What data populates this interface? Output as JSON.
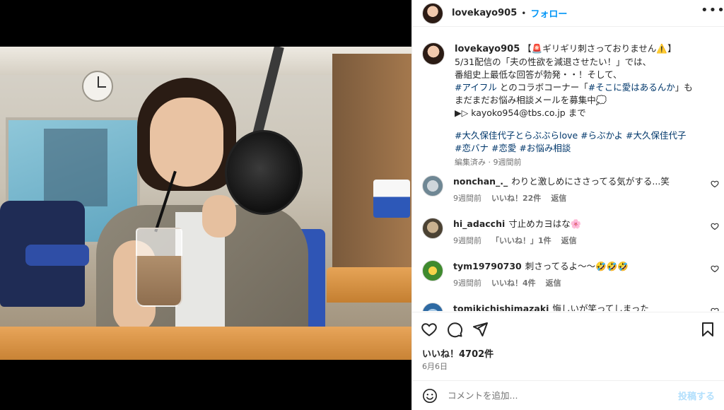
{
  "post": {
    "username": "lovekayo905",
    "dot": "•",
    "follow_label": "フォロー",
    "more_icon": "more-horizontal-icon"
  },
  "caption": {
    "username": "lovekayo905",
    "line1": "【🚨ギリギリ刺さっておりません⚠️】",
    "line2": "5/31配信の「夫の性欲を減退させたい！」では、",
    "line3": "番組史上最低な回答が勃発・・！そして、",
    "line4_tag": "#アイフル",
    "line4_mid": " とのコラボコーナー「",
    "line4_tag2": "#そこに愛はあるんか",
    "line4_end": "」も",
    "line5": "まだまだお悩み相談メールを募集中💭",
    "line6": "▶︎▷ kayoko954@tbs.co.jp まで",
    "hashtags_line1": "#大久保佳代子とらぶぶらlove #らぶかよ #大久保佳代子",
    "hashtags_line2": "#恋バナ #恋愛 #お悩み相談",
    "meta": "編集済み · 9週間前"
  },
  "comments": [
    {
      "username": "nonchan_._",
      "text": "わりと激しめにささってる気がする...笑",
      "time": "9週間前",
      "likes": "いいね！22件",
      "reply": "返信"
    },
    {
      "username": "hi_adacchi",
      "text": "寸止めカヨはな🌸",
      "time": "9週間前",
      "likes": "「いいね！」1件",
      "reply": "返信"
    },
    {
      "username": "tym19790730",
      "text": "刺さってるよ〜〜🤣🤣🤣",
      "time": "9週間前",
      "likes": "いいね！4件",
      "reply": "返信"
    },
    {
      "username": "tomikichishimazaki",
      "text": "悔しいが笑ってしまった"
    }
  ],
  "likes_count": "いいね！4702件",
  "date": "6月6日",
  "add_comment": {
    "placeholder": "コメントを追加...",
    "post_label": "投稿する"
  },
  "colors": {
    "link_blue": "#0095f6",
    "hashtag_blue": "#00376b",
    "text": "#262626",
    "secondary": "#737373"
  }
}
